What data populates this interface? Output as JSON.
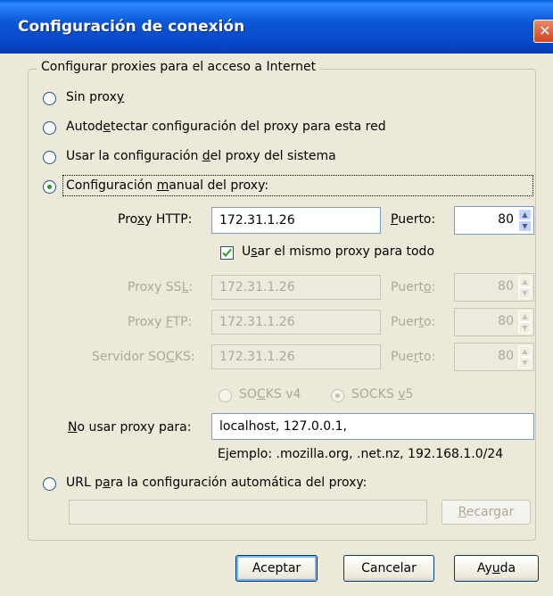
{
  "window": {
    "title": "Configuración de conexión",
    "close_glyph": "✕"
  },
  "group": {
    "legend": "Configurar proxies para el acceso a Internet"
  },
  "options": {
    "no_proxy": {
      "pre": "Sin prox",
      "key": "y",
      "post": "",
      "selected": false
    },
    "autodetect": {
      "pre": "Autod",
      "key": "e",
      "post": "tectar configuración del proxy para esta red",
      "selected": false
    },
    "system": {
      "pre": "Usar la configuración ",
      "key": "d",
      "post": "el proxy del sistema",
      "selected": false
    },
    "manual": {
      "pre": "Configuración ",
      "key": "m",
      "post": "anual del proxy:",
      "selected": true
    },
    "auto_url": {
      "pre": "URL p",
      "key": "a",
      "post": "ra la configuración automática del proxy:",
      "selected": false
    }
  },
  "http": {
    "label_pre": "Pro",
    "label_key": "x",
    "label_post": "y HTTP:",
    "value": "172.31.1.26",
    "port_label_pre": "",
    "port_label_key": "P",
    "port_label_post": "uerto:",
    "port": "80"
  },
  "same_proxy": {
    "pre": "U",
    "key": "s",
    "post": "ar el mismo proxy para todo",
    "checked": true
  },
  "ssl": {
    "label_pre": "Proxy SS",
    "label_key": "L",
    "label_post": ":",
    "value": "172.31.1.26",
    "port_label_pre": "Puert",
    "port_label_key": "o",
    "port_label_post": ":",
    "port": "80"
  },
  "ftp": {
    "label_pre": "Proxy ",
    "label_key": "F",
    "label_post": "TP:",
    "value": "172.31.1.26",
    "port_label_pre": "Puer",
    "port_label_key": "t",
    "port_label_post": "o:",
    "port": "80"
  },
  "socks": {
    "label_pre": "Servidor SO",
    "label_key": "C",
    "label_post": "KS:",
    "value": "172.31.1.26",
    "port_label_pre": "Pue",
    "port_label_key": "r",
    "port_label_post": "to:",
    "port": "80",
    "v4": {
      "pre": "SO",
      "key": "C",
      "post": "KS v4",
      "selected": false
    },
    "v5": {
      "pre": "SOCKS ",
      "key": "v",
      "post": "5",
      "selected": true
    }
  },
  "no_proxy_for": {
    "label_pre": "",
    "label_key": "N",
    "label_post": "o usar proxy para:",
    "value": "localhost, 127.0.0.1,",
    "example": "Ejemplo: .mozilla.org, .net.nz, 192.168.1.0/24"
  },
  "auto_url": {
    "value": "",
    "reload_pre": "",
    "reload_key": "R",
    "reload_post": "ecargar"
  },
  "footer": {
    "ok": "Aceptar",
    "cancel": "Cancelar",
    "help_pre": "Ay",
    "help_key": "u",
    "help_post": "da"
  },
  "icons": {
    "spin_up": "▲",
    "spin_down": "▼",
    "checkmark": "check-icon"
  }
}
